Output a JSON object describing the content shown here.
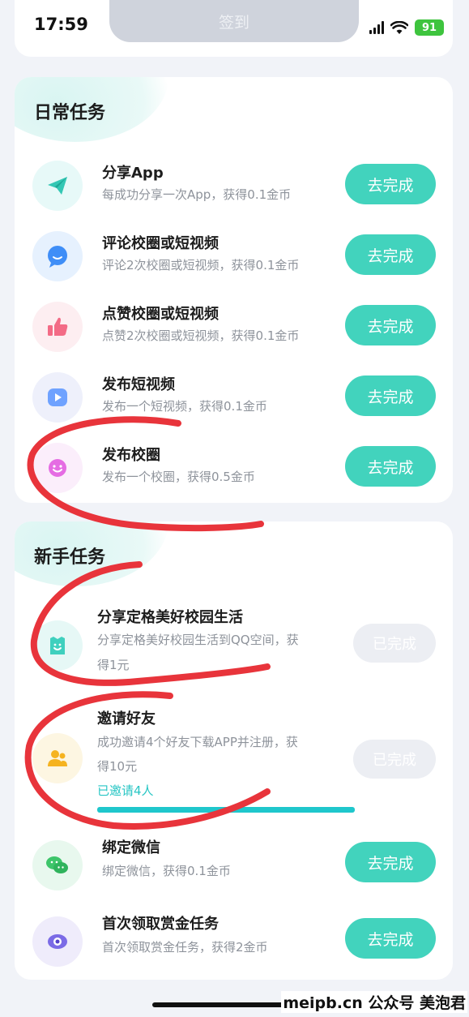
{
  "status_bar": {
    "time": "17:59",
    "battery": "91"
  },
  "checkin_label": "签到",
  "daily": {
    "title": "日常任务",
    "tasks": [
      {
        "title": "分享App",
        "desc": "每成功分享一次App，获得0.1金币",
        "button": "去完成",
        "icon": "paper-plane-icon"
      },
      {
        "title": "评论校圈或短视频",
        "desc": "评论2次校圈或短视频，获得0.1金币",
        "button": "去完成",
        "icon": "chat-bubble-icon"
      },
      {
        "title": "点赞校圈或短视频",
        "desc": "点赞2次校圈或短视频，获得0.1金币",
        "button": "去完成",
        "icon": "thumbs-up-icon"
      },
      {
        "title": "发布短视频",
        "desc": "发布一个短视频，获得0.1金币",
        "button": "去完成",
        "icon": "play-icon"
      },
      {
        "title": "发布校圈",
        "desc": "发布一个校圈，获得0.5金币",
        "button": "去完成",
        "icon": "smiley-icon"
      }
    ]
  },
  "newbie": {
    "title": "新手任务",
    "tasks": [
      {
        "title": "分享定格美好校园生活",
        "desc_line1": "分享定格美好校园生活到QQ空间，获",
        "desc_line2": "得1元",
        "button": "已完成",
        "icon": "bag-icon"
      },
      {
        "title": "邀请好友",
        "desc_line1": "成功邀请4个好友下载APP并注册，获",
        "desc_line2": "得10元",
        "status": "已邀请4人",
        "progress": 1.0,
        "button": "已完成",
        "icon": "users-icon"
      },
      {
        "title": "绑定微信",
        "desc": "绑定微信，获得0.1金币",
        "button": "去完成",
        "icon": "wechat-icon"
      },
      {
        "title": "首次领取赏金任务",
        "desc": "首次领取赏金任务，获得2金币",
        "button": "去完成",
        "icon": "eye-icon"
      }
    ]
  },
  "watermark": "meipb.cn  公众号 美泡君",
  "colors": {
    "accent": "#42d3bd",
    "annotation": "#e8343b",
    "progress": "#1fc7cc"
  }
}
